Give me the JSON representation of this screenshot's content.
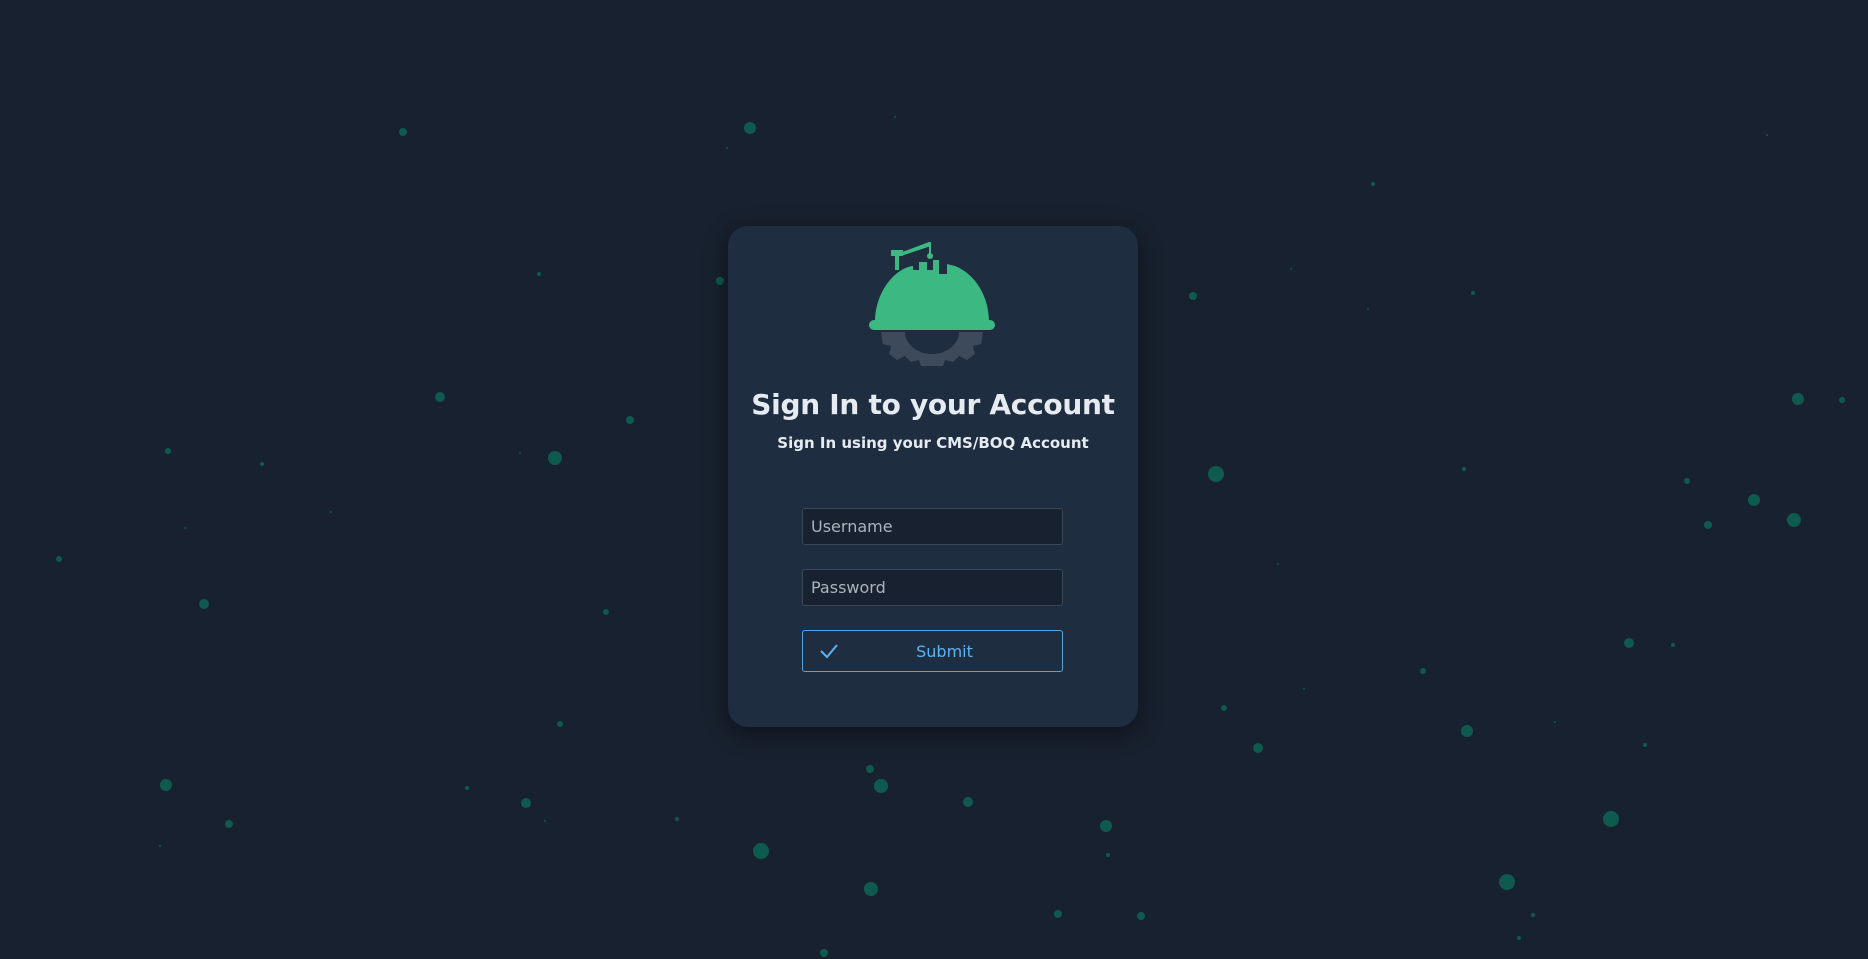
{
  "login": {
    "title": "Sign In to your Account",
    "subtitle": "Sign In using your CMS/BOQ Account",
    "username_placeholder": "Username",
    "password_placeholder": "Password",
    "username_value": "",
    "password_value": "",
    "submit_label": "Submit",
    "submit_icon": "check-icon",
    "logo_icon": "hard-hat-gear-logo"
  },
  "theme": {
    "background": "#18212f",
    "card": "#1f2d41",
    "accent_green": "#3cb983",
    "gear_gray": "#3d4a5c",
    "button_blue": "#4fa6e6",
    "particle": "#0f5a4e"
  }
}
